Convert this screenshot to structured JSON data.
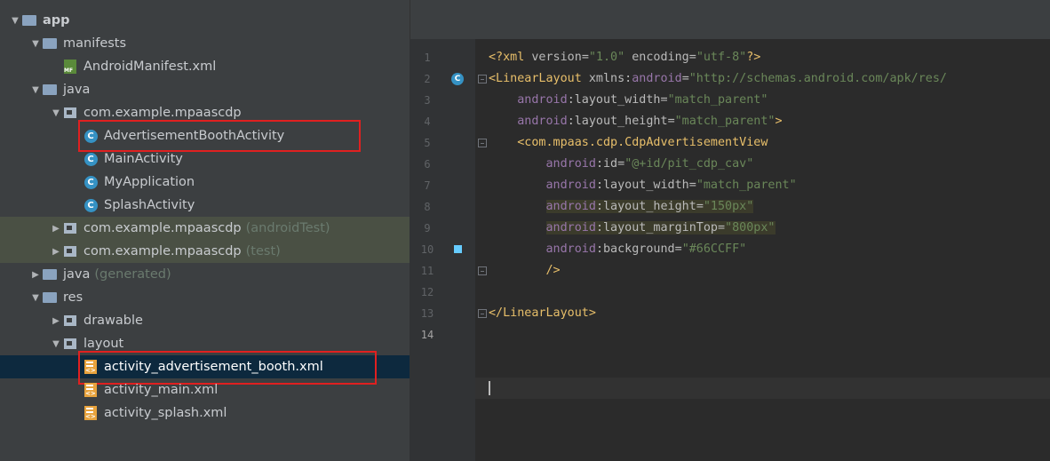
{
  "tree": [
    {
      "label": "app",
      "indent": 0,
      "arrow": "open",
      "icon": "module-folder-icon",
      "bold": true
    },
    {
      "label": "manifests",
      "indent": 1,
      "arrow": "open",
      "icon": "folder-icon"
    },
    {
      "label": "AndroidManifest.xml",
      "indent": 2,
      "arrow": "none",
      "icon": "manifest-file-icon"
    },
    {
      "label": "java",
      "indent": 1,
      "arrow": "open",
      "icon": "folder-icon"
    },
    {
      "label": "com.example.mpaascdp",
      "indent": 2,
      "arrow": "open",
      "icon": "package-icon"
    },
    {
      "label": "AdvertisementBoothActivity",
      "indent": 3,
      "arrow": "none",
      "icon": "class-icon",
      "boxed": true
    },
    {
      "label": "MainActivity",
      "indent": 3,
      "arrow": "none",
      "icon": "class-icon"
    },
    {
      "label": "MyApplication",
      "indent": 3,
      "arrow": "none",
      "icon": "class-icon"
    },
    {
      "label": "SplashActivity",
      "indent": 3,
      "arrow": "none",
      "icon": "class-icon"
    },
    {
      "label": "com.example.mpaascdp",
      "suffix": "(androidTest)",
      "indent": 2,
      "arrow": "closed",
      "icon": "package-icon",
      "highlight": true
    },
    {
      "label": "com.example.mpaascdp",
      "suffix": "(test)",
      "indent": 2,
      "arrow": "closed",
      "icon": "package-icon",
      "highlight": true
    },
    {
      "label": "java",
      "suffix": "(generated)",
      "indent": 1,
      "arrow": "closed",
      "icon": "generated-folder-icon"
    },
    {
      "label": "res",
      "indent": 1,
      "arrow": "open",
      "icon": "res-folder-icon"
    },
    {
      "label": "drawable",
      "indent": 2,
      "arrow": "closed",
      "icon": "package-icon"
    },
    {
      "label": "layout",
      "indent": 2,
      "arrow": "open",
      "icon": "package-icon"
    },
    {
      "label": "activity_advertisement_booth.xml",
      "indent": 3,
      "arrow": "none",
      "icon": "xml-file-icon",
      "selected": true,
      "boxed": true
    },
    {
      "label": "activity_main.xml",
      "indent": 3,
      "arrow": "none",
      "icon": "xml-file-icon"
    },
    {
      "label": "activity_splash.xml",
      "indent": 3,
      "arrow": "none",
      "icon": "xml-file-icon"
    }
  ],
  "editor": {
    "line_numbers": [
      "1",
      "2",
      "3",
      "4",
      "5",
      "6",
      "7",
      "8",
      "9",
      "10",
      "11",
      "12",
      "13",
      "14"
    ],
    "current_line": "14",
    "gutter_marks": {
      "class_marker_line": "2",
      "color_swatch_line": "10",
      "color_swatch": "#66CCFF"
    },
    "lines": [
      [
        {
          "t": "<?",
          "c": "tag"
        },
        {
          "t": "xml ",
          "c": "tag"
        },
        {
          "t": "version",
          "c": "attr"
        },
        {
          "t": "=",
          "c": "attr"
        },
        {
          "t": "\"1.0\"",
          "c": "str"
        },
        {
          "t": " encoding",
          "c": "attr"
        },
        {
          "t": "=",
          "c": "attr"
        },
        {
          "t": "\"utf-8\"",
          "c": "str"
        },
        {
          "t": "?>",
          "c": "tag"
        }
      ],
      [
        {
          "t": "<LinearLayout ",
          "c": "tag"
        },
        {
          "t": "xmlns:",
          "c": "attr"
        },
        {
          "t": "android",
          "c": "ns"
        },
        {
          "t": "=",
          "c": "attr"
        },
        {
          "t": "\"http://schemas.android.com/apk/res/",
          "c": "str"
        }
      ],
      [
        {
          "t": "    "
        },
        {
          "t": "android",
          "c": "ns"
        },
        {
          "t": ":layout_width",
          "c": "attr"
        },
        {
          "t": "=",
          "c": "attr"
        },
        {
          "t": "\"match_parent\"",
          "c": "str"
        }
      ],
      [
        {
          "t": "    "
        },
        {
          "t": "android",
          "c": "ns"
        },
        {
          "t": ":layout_height",
          "c": "attr"
        },
        {
          "t": "=",
          "c": "attr"
        },
        {
          "t": "\"match_parent\"",
          "c": "str"
        },
        {
          "t": ">",
          "c": "tag"
        }
      ],
      [
        {
          "t": "    "
        },
        {
          "t": "<com.mpaas.cdp.CdpAdvertisementView",
          "c": "tag"
        }
      ],
      [
        {
          "t": "        "
        },
        {
          "t": "android",
          "c": "ns"
        },
        {
          "t": ":id",
          "c": "attr"
        },
        {
          "t": "=",
          "c": "attr"
        },
        {
          "t": "\"@+id/pit_cdp_cav\"",
          "c": "str"
        }
      ],
      [
        {
          "t": "        "
        },
        {
          "t": "android",
          "c": "ns"
        },
        {
          "t": ":layout_width",
          "c": "attr"
        },
        {
          "t": "=",
          "c": "attr"
        },
        {
          "t": "\"match_parent\"",
          "c": "str"
        }
      ],
      [
        {
          "t": "        "
        },
        {
          "t": "android",
          "c": "ns",
          "h": true
        },
        {
          "t": ":layout_height",
          "c": "attr",
          "h": true
        },
        {
          "t": "=",
          "c": "attr",
          "h": true
        },
        {
          "t": "\"150px\"",
          "c": "str",
          "h": true
        }
      ],
      [
        {
          "t": "        "
        },
        {
          "t": "android",
          "c": "ns",
          "h": true
        },
        {
          "t": ":layout_marginTop",
          "c": "attr",
          "h": true
        },
        {
          "t": "=",
          "c": "attr",
          "h": true
        },
        {
          "t": "\"800px\"",
          "c": "str",
          "h": true
        }
      ],
      [
        {
          "t": "        "
        },
        {
          "t": "android",
          "c": "ns"
        },
        {
          "t": ":background",
          "c": "attr"
        },
        {
          "t": "=",
          "c": "attr"
        },
        {
          "t": "\"#66CCFF\"",
          "c": "str"
        }
      ],
      [
        {
          "t": "        "
        },
        {
          "t": "/>",
          "c": "tag"
        }
      ],
      [],
      [
        {
          "t": "</LinearLayout>",
          "c": "tag"
        }
      ],
      []
    ]
  }
}
